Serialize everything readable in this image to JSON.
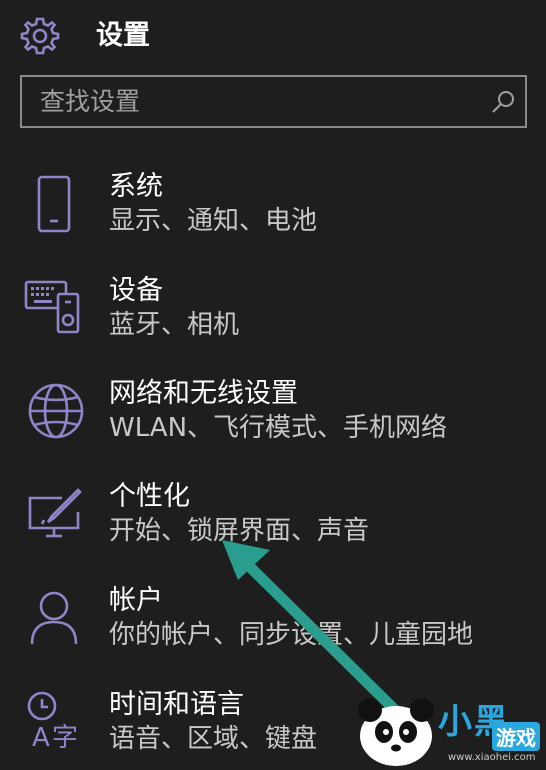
{
  "header": {
    "title": "设置",
    "icon": "gear-icon"
  },
  "search": {
    "placeholder": "查找设置",
    "icon": "search-icon"
  },
  "accent_color": "#8e86c8",
  "items": [
    {
      "icon": "phone-icon",
      "title": "系统",
      "subtitle": "显示、通知、电池"
    },
    {
      "icon": "devices-icon",
      "title": "设备",
      "subtitle": "蓝牙、相机"
    },
    {
      "icon": "globe-icon",
      "title": "网络和无线设置",
      "subtitle": "WLAN、飞行模式、手机网络"
    },
    {
      "icon": "personalization-icon",
      "title": "个性化",
      "subtitle": "开始、锁屏界面、声音"
    },
    {
      "icon": "user-icon",
      "title": "帐户",
      "subtitle": "你的帐户、同步设置、儿童园地"
    },
    {
      "icon": "time-language-icon",
      "title": "时间和语言",
      "subtitle": "语音、区域、键盘"
    }
  ],
  "annotation": {
    "type": "arrow",
    "color": "#2a9d8f",
    "target_item": "个性化"
  },
  "watermark": {
    "brand": "小黑",
    "tag": "游戏",
    "url": "www.xiaohei.com"
  }
}
